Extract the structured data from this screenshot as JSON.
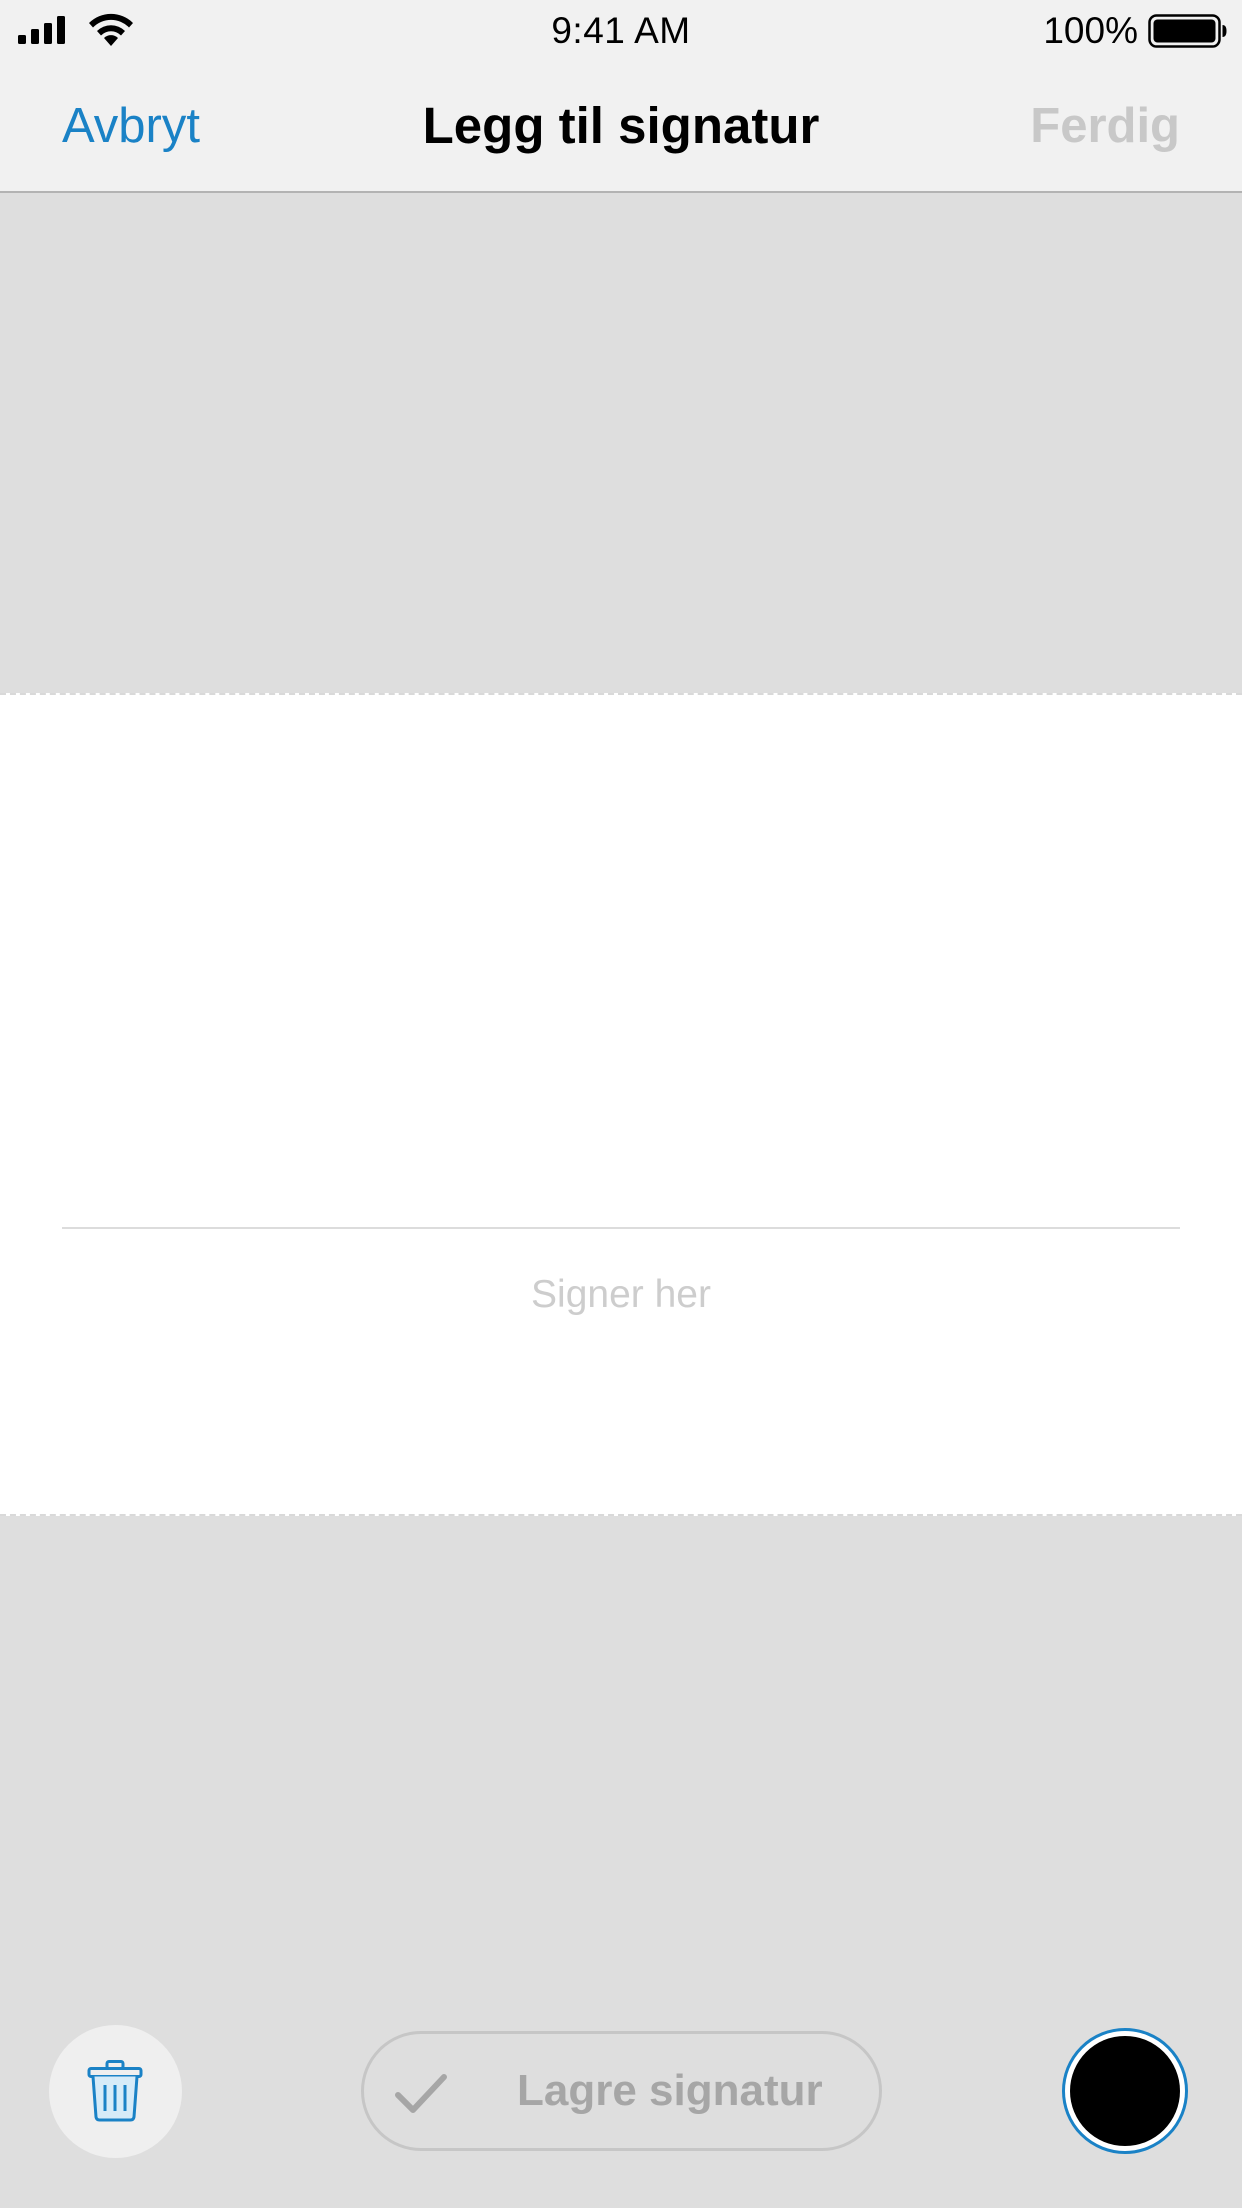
{
  "status_bar": {
    "time": "9:41 AM",
    "battery_percent": "100%",
    "signal_icon": "cellular-signal-icon",
    "wifi_icon": "wifi-icon",
    "battery_icon": "battery-full-icon"
  },
  "nav": {
    "cancel_label": "Avbryt",
    "title": "Legg til signatur",
    "done_label": "Ferdig"
  },
  "signature": {
    "hint": "Signer her"
  },
  "toolbar": {
    "clear_icon": "trash-icon",
    "save_icon": "checkmark-icon",
    "save_label": "Lagre signatur",
    "pen_color": "#000000"
  },
  "colors": {
    "accent": "#1a82c6",
    "disabled_text": "#c8c8c8",
    "canvas_background": "#dedede",
    "pad_background": "#ffffff"
  }
}
